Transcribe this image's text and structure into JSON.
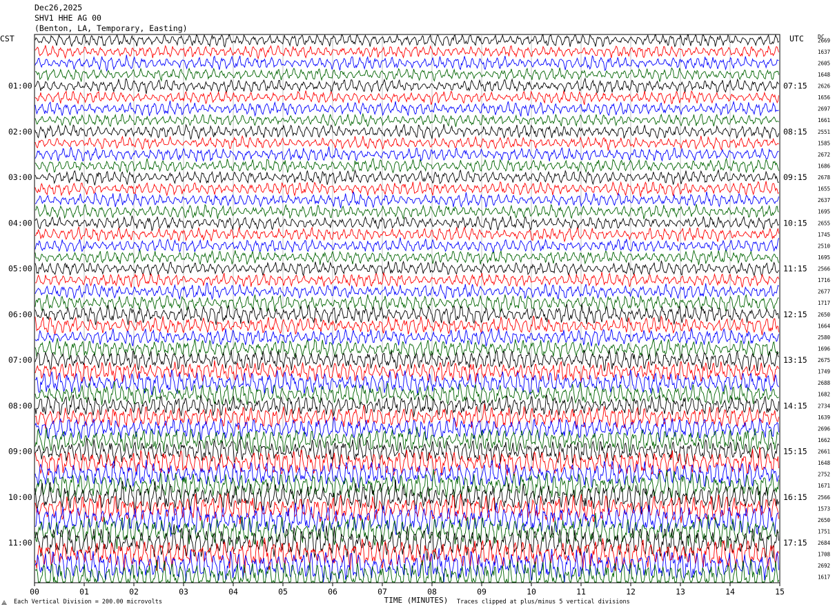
{
  "header": {
    "date": "Dec26,2025",
    "station": "SHV1 HHE AG 00",
    "location": "(Benton, LA, Temporary, Easting)"
  },
  "chart_data": {
    "type": "line",
    "title": "",
    "xlabel": "TIME (MINUTES)",
    "x_ticks": [
      "00",
      "01",
      "02",
      "03",
      "04",
      "05",
      "06",
      "07",
      "08",
      "09",
      "10",
      "11",
      "12",
      "13",
      "14",
      "15"
    ],
    "xlim": [
      0,
      15
    ],
    "left_axis_label": "CST",
    "right_axis_label": "UTC",
    "dc_label": "DC",
    "left_hour_labels": [
      "01:00",
      "02:00",
      "03:00",
      "04:00",
      "05:00",
      "06:00",
      "07:00",
      "08:00",
      "09:00",
      "10:00",
      "11:00"
    ],
    "right_hour_labels": [
      "07:15",
      "08:15",
      "09:15",
      "10:15",
      "11:15",
      "12:15",
      "13:15",
      "14:15",
      "15:15",
      "16:15",
      "17:15"
    ],
    "trace_colors": [
      "#000000",
      "#ff0000",
      "#0000ff",
      "#006400"
    ],
    "trace_count": 48,
    "traces_per_hour": 4,
    "dc_offsets": [
      "2669",
      "1637",
      "2605",
      "1648",
      "2626",
      "1656",
      "2697",
      "1661",
      "2551",
      "1585",
      "2672",
      "1686",
      "2678",
      "1655",
      "2637",
      "1695",
      "2655",
      "1745",
      "2510",
      "1695",
      "2566",
      "1716",
      "2677",
      "1717",
      "2650",
      "1664",
      "2580",
      "1696",
      "2675",
      "1749",
      "2688",
      "1682",
      "2734",
      "1639",
      "2696",
      "1662",
      "2661",
      "1648",
      "2752",
      "1671",
      "2566",
      "1573",
      "2650",
      "1751",
      "2684",
      "1708",
      "2692",
      "1617"
    ],
    "amplitude_profile": [
      0.55,
      0.5,
      0.55,
      0.5,
      0.55,
      0.5,
      0.55,
      0.5,
      0.55,
      0.5,
      0.55,
      0.55,
      0.55,
      0.55,
      0.55,
      0.55,
      0.55,
      0.55,
      0.55,
      0.55,
      0.55,
      0.55,
      0.6,
      0.65,
      0.75,
      0.7,
      0.65,
      0.75,
      0.8,
      0.85,
      0.9,
      0.85,
      0.85,
      0.9,
      0.9,
      1.0,
      1.0,
      1.05,
      1.05,
      1.1,
      1.15,
      1.15,
      1.2,
      1.2,
      1.25,
      1.25,
      1.3,
      1.35
    ],
    "grid": "vertical"
  },
  "footer": {
    "scale_note": "Each Vertical Division =  200.00 microvolts",
    "clip_note": "Traces clipped at plus/minus 5 vertical divisions",
    "logo_mark": "⟁"
  }
}
